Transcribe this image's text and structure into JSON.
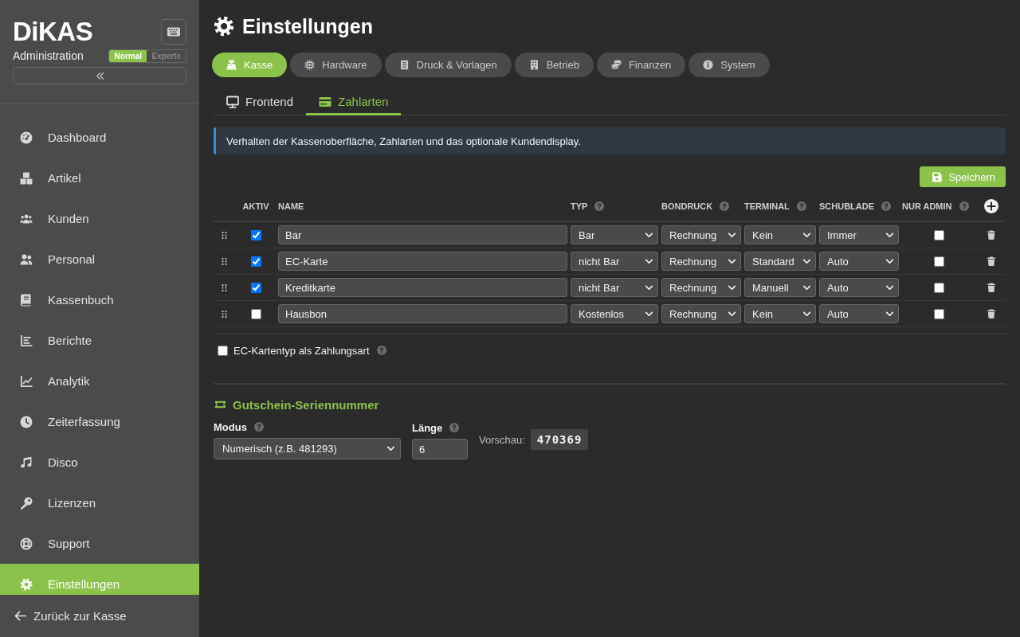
{
  "sidebar": {
    "logo": "DiKAS",
    "subtitle": "Administration",
    "modes": [
      {
        "label": "Normal",
        "selected": true
      },
      {
        "label": "Experte",
        "selected": false
      }
    ],
    "nav": [
      {
        "label": "Dashboard",
        "selected": false
      },
      {
        "label": "Artikel",
        "selected": false
      },
      {
        "label": "Kunden",
        "selected": false
      },
      {
        "label": "Personal",
        "selected": false
      },
      {
        "label": "Kassenbuch",
        "selected": false
      },
      {
        "label": "Berichte",
        "selected": false
      },
      {
        "label": "Analytik",
        "selected": false
      },
      {
        "label": "Zeiterfassung",
        "selected": false
      },
      {
        "label": "Disco",
        "selected": false
      },
      {
        "label": "Lizenzen",
        "selected": false
      },
      {
        "label": "Support",
        "selected": false
      },
      {
        "label": "Einstellungen",
        "selected": true
      }
    ],
    "footer_link": "Zurück zur Kasse"
  },
  "page": {
    "title": "Einstellungen",
    "tabs": [
      {
        "label": "Kasse",
        "selected": true
      },
      {
        "label": "Hardware",
        "selected": false
      },
      {
        "label": "Druck & Vorlagen",
        "selected": false
      },
      {
        "label": "Betrieb",
        "selected": false
      },
      {
        "label": "Finanzen",
        "selected": false
      },
      {
        "label": "System",
        "selected": false
      }
    ],
    "subtabs": [
      {
        "label": "Frontend",
        "selected": false
      },
      {
        "label": "Zahlarten",
        "selected": true
      }
    ],
    "info": "Verhalten der Kassenoberfläche, Zahlarten und das optionale Kundendisplay.",
    "save_button": "Speichern"
  },
  "payment_table": {
    "columns": [
      {
        "label": "AKTIV",
        "help": false
      },
      {
        "label": "NAME",
        "help": false
      },
      {
        "label": "TYP",
        "help": true
      },
      {
        "label": "BONDRUCK",
        "help": true
      },
      {
        "label": "TERMINAL",
        "help": true
      },
      {
        "label": "SCHUBLADE",
        "help": true
      },
      {
        "label": "NUR ADMIN",
        "help": true
      }
    ],
    "rows": [
      {
        "active": true,
        "name": "Bar",
        "type": "Bar",
        "receipt": "Rechnung",
        "terminal": "Kein",
        "drawer": "Immer",
        "admin_only": false
      },
      {
        "active": true,
        "name": "EC-Karte",
        "type": "nicht Bar",
        "receipt": "Rechnung",
        "terminal": "Standard",
        "drawer": "Auto",
        "admin_only": false
      },
      {
        "active": true,
        "name": "Kreditkarte",
        "type": "nicht Bar",
        "receipt": "Rechnung",
        "terminal": "Manuell",
        "drawer": "Auto",
        "admin_only": false
      },
      {
        "active": false,
        "name": "Hausbon",
        "type": "Kostenlos",
        "receipt": "Rechnung",
        "terminal": "Kein",
        "drawer": "Auto",
        "admin_only": false
      }
    ]
  },
  "ec_card_option": {
    "label": "EC-Kartentyp als Zahlungsart",
    "checked": false,
    "help": true
  },
  "voucher": {
    "title": "Gutschein-Seriennummer",
    "mode": {
      "label": "Modus",
      "help": true,
      "value": "Numerisch (z.B. 481293)"
    },
    "length": {
      "label": "Länge",
      "help": true,
      "value": "6"
    },
    "preview": {
      "label": "Vorschau:",
      "value": "470369"
    }
  }
}
